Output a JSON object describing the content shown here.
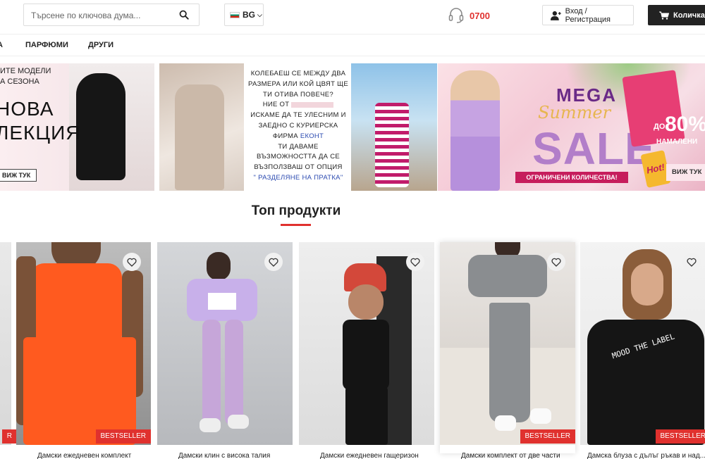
{
  "header": {
    "search": {
      "placeholder": "Търсене по ключова дума..."
    },
    "language": {
      "code": "BG"
    },
    "phone": {
      "number": "0700"
    },
    "login": {
      "label": "Вход / Регистрация"
    },
    "cart": {
      "label": "Количка"
    }
  },
  "nav": {
    "items": [
      {
        "label": "А"
      },
      {
        "label": "ПАРФЮМИ"
      },
      {
        "label": "ДРУГИ"
      }
    ]
  },
  "banners": {
    "b1": {
      "line1": "ИТЕ МОДЕЛИ",
      "line2": "А СЕЗОНА",
      "big1": "НОВА",
      "big2": "ЛЕКЦИЯ",
      "button": "ВИЖ ТУК"
    },
    "b3": {
      "l1": "КОЛЕБАЕШ СЕ МЕЖДУ ДВА",
      "l2": "РАЗМЕРА ИЛИ КОЙ ЦВЯТ ЩЕ",
      "l3": "ТИ ОТИВА ПОВЕЧЕ?",
      "l4": "НИЕ ОТ",
      "l5": "ИСКАМЕ ДА ТЕ УЛЕСНИМ И",
      "l6": "ЗАЕДНО С КУРИЕРСКА",
      "l7a": "ФИРМА",
      "l7b": "ЕКОНТ",
      "l8": "ТИ ДАВАМЕ",
      "l9": "ВЪЗМОЖНОСТТА ДА СЕ",
      "l10": "ВЪЗПОЛЗВАШ ОТ ОПЦИЯ",
      "l11": "\" РАЗДЕЛЯНЕ НА ПРАТКА\""
    },
    "b5": {
      "mega": "MEGA",
      "summer": "Summer",
      "sale": "SALE",
      "limited": "ОГРАНИЧЕНИ КОЛИЧЕСТВА!",
      "do": "ДО",
      "percent": "80%",
      "discount": "НАМАЛЕНИ",
      "hot": "Hot!",
      "button": "ВИЖ ТУК"
    }
  },
  "section": {
    "title": "Топ продукти"
  },
  "products": [
    {
      "name": "",
      "badge": ""
    },
    {
      "name": "Дамски ежедневен комплект",
      "badge": "BESTSELLER"
    },
    {
      "name": "Дамски клин с висока талия",
      "badge": ""
    },
    {
      "name": "Дамски ежедневен гащеризон",
      "badge": ""
    },
    {
      "name": "Дамски комплект от две части",
      "badge": "BESTSELLER"
    },
    {
      "name": "Дамска блуза с дълъг ръкав и над...",
      "badge": "BESTSELLER"
    }
  ],
  "colors": {
    "accent": "#e0312e",
    "cart_bg": "#222222",
    "sale_purple": "#b27ec9",
    "sale_pink": "#c61d5c"
  },
  "icons": [
    "search-icon",
    "headset-icon",
    "user-icon",
    "cart-icon",
    "heart-icon",
    "chevron-down-icon"
  ]
}
